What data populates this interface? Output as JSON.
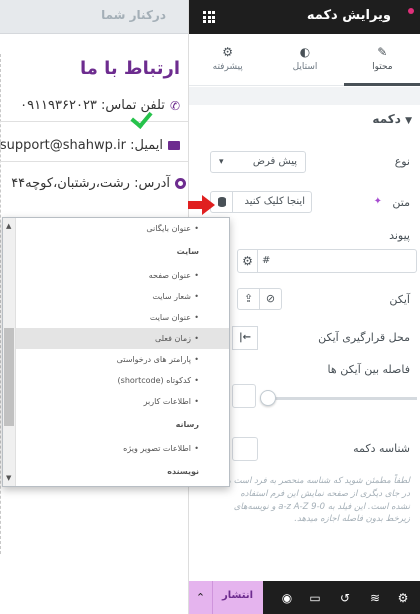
{
  "preview": {
    "tab_label": "درکنار شما",
    "title": "ارتباط با ما",
    "phone_line": "تلفن تماس: ۰۹۱۱۹۳۶۲۰۲۳",
    "email_line": "ایمیل: support@shahwp.ir",
    "address_line": "آدرس: رشت،رشتبان،کوچه۴۴"
  },
  "dropdown": {
    "items": [
      {
        "type": "item",
        "label": "عنوان بایگانی"
      },
      {
        "type": "header",
        "label": "سایت"
      },
      {
        "type": "item",
        "label": "عنوان صفحه"
      },
      {
        "type": "item",
        "label": "شعار سایت"
      },
      {
        "type": "item",
        "label": "عنوان سایت"
      },
      {
        "type": "item",
        "label": "زمان فعلی",
        "selected": true
      },
      {
        "type": "item",
        "label": "پارامتر های درخواستی"
      },
      {
        "type": "item",
        "label": "کدکوتاه (shortcode)"
      },
      {
        "type": "item",
        "label": "اطلاعات کاربر"
      },
      {
        "type": "header",
        "label": "رسانه"
      },
      {
        "type": "item",
        "label": "اطلاعات تصویر ویژه"
      },
      {
        "type": "header",
        "label": "نویسنده"
      }
    ]
  },
  "panel": {
    "title": "ویرایش دکمه",
    "tabs": [
      {
        "label": "محتوا",
        "icon": "pencil-icon",
        "active": true
      },
      {
        "label": "استایل",
        "icon": "contrast-icon",
        "active": false
      },
      {
        "label": "پیشرفته",
        "icon": "gear-icon",
        "active": false
      }
    ],
    "section_title": "دکمه",
    "type_label": "نوع",
    "type_value": "پیش فرض",
    "text_label": "متن",
    "text_value": "اینجا کلیک کنید",
    "link_label": "پیوند",
    "link_value": "#",
    "icon_label": "آیکن",
    "icon_position_label": "محل قرارگیری آیکن",
    "icon_spacing_label": "فاصله بین آیکن ها",
    "button_id_label": "شناسه دکمه",
    "help_text": "لطفاً مطمئن شوید که شناسه منحصر به فرد است و در جای دیگری از صفحه نمایش این فرم استفاده نشده است. این فیلد به 0-9 a-z A-Z و نویسه‌های زیرخط بدون فاصله اجازه میدهد.",
    "publish_label": "انتشار"
  }
}
